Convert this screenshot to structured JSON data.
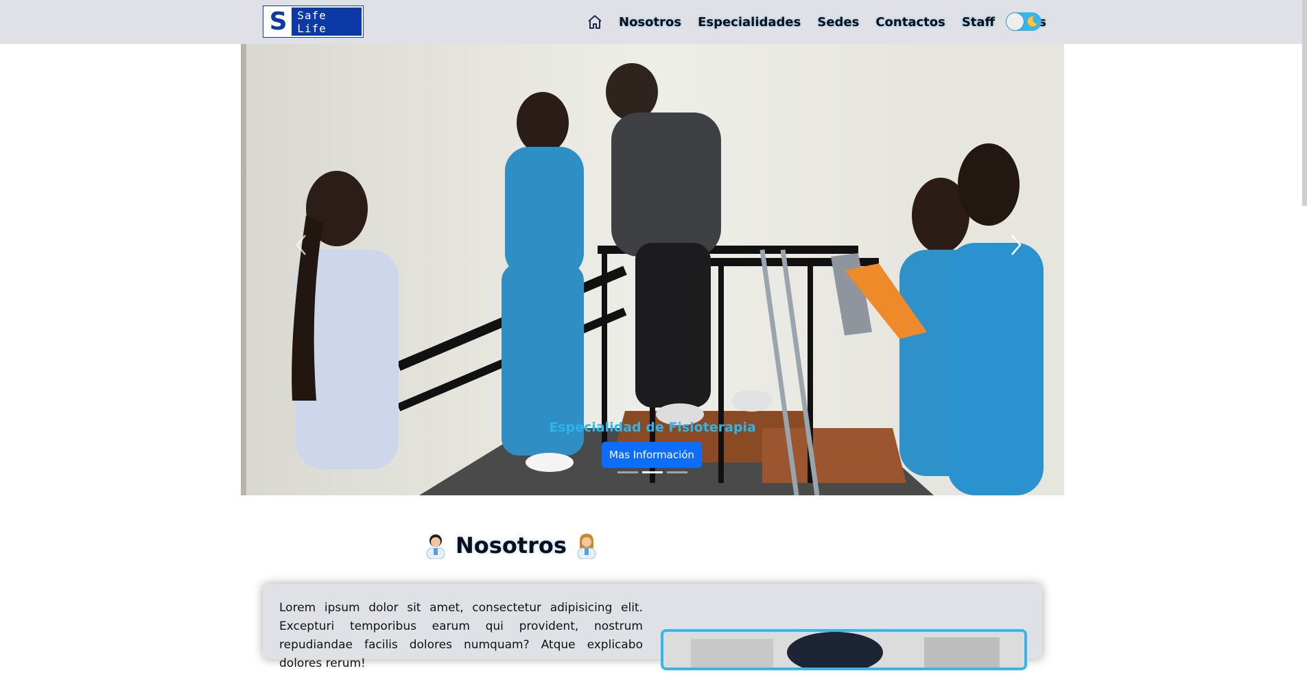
{
  "brand": {
    "letter": "S",
    "name": "Safe Life"
  },
  "nav": {
    "home_icon": "home-icon",
    "links": [
      "Nosotros",
      "Especialidades",
      "Sedes",
      "Contactos",
      "Staff",
      "Citas"
    ],
    "theme_toggle_icon": "moon-icon"
  },
  "carousel": {
    "caption": "Especialidad de Fisioterapia",
    "button_label": "Mas Información",
    "prev_icon": "chevron-left-icon",
    "next_icon": "chevron-right-icon",
    "slide_count": 3,
    "active_slide": 2
  },
  "about": {
    "title": "Nosotros",
    "title_icon": "doctor-emoji-icon",
    "text": "Lorem ipsum dolor sit amet, consectetur adipisicing elit. Excepturi temporibus earum qui provident, nostrum repudiandae facilis dolores numquam? Atque explicabo dolores rerum!"
  },
  "colors": {
    "navbar_bg": "#dfe1e6",
    "brand_blue": "#0b3aa6",
    "accent_cyan": "#35b6ef",
    "button_blue": "#0d6efd"
  }
}
